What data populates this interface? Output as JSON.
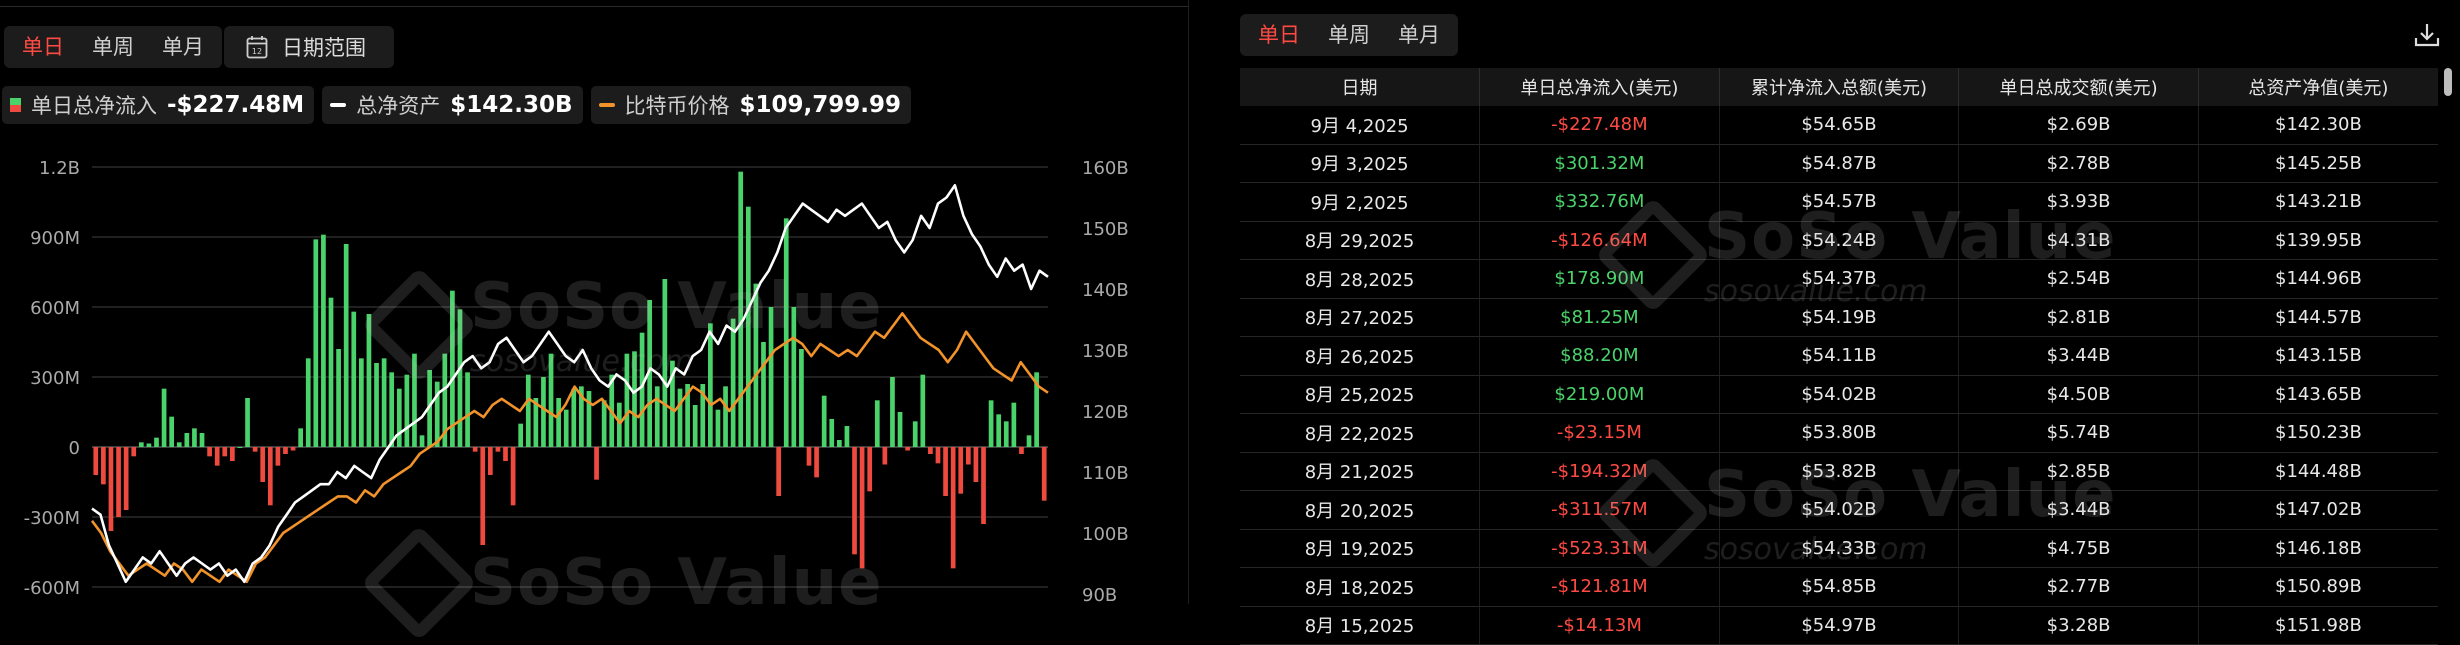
{
  "left_tabs": [
    "单日",
    "单周",
    "单月"
  ],
  "date_range_label": "日期范围",
  "date_icon_text": "12",
  "legend": {
    "flow": {
      "label": "单日总净流入",
      "value": "-$227.48M"
    },
    "assets": {
      "label": "总净资产",
      "value": "$142.30B"
    },
    "price": {
      "label": "比特币价格",
      "value": "$109,799.99"
    }
  },
  "watermark": {
    "text": "SoSo Value",
    "sub": "sosovalue.com"
  },
  "colors": {
    "accent": "#ff4a43",
    "inflow": "#4ad36a",
    "outflow": "#ef4a3f",
    "assets_line": "#ffffff",
    "price_line": "#f2922a"
  },
  "chart_data": {
    "type": "bar",
    "left_axis": {
      "ticks": [
        "1.2B",
        "900M",
        "600M",
        "300M",
        "0",
        "-300M",
        "-600M"
      ],
      "range": [
        -680,
        1200
      ]
    },
    "right_axis": {
      "ticks": [
        "160B",
        "150B",
        "140B",
        "130B",
        "120B",
        "110B",
        "100B",
        "90B"
      ],
      "range": [
        88,
        160
      ]
    },
    "series": [
      {
        "name": "单日总净流入",
        "type": "bar",
        "unit": "M",
        "values": [
          -120,
          -160,
          -360,
          -300,
          -270,
          -40,
          20,
          15,
          40,
          250,
          130,
          20,
          60,
          80,
          60,
          -40,
          -80,
          -40,
          -60,
          0,
          210,
          -20,
          -150,
          -250,
          -80,
          -30,
          -15,
          80,
          380,
          890,
          910,
          640,
          420,
          870,
          580,
          380,
          570,
          360,
          380,
          320,
          250,
          310,
          400,
          50,
          330,
          280,
          400,
          670,
          590,
          320,
          -20,
          -420,
          -120,
          -20,
          -60,
          -250,
          100,
          310,
          210,
          300,
          400,
          210,
          160,
          250,
          260,
          240,
          -140,
          200,
          310,
          190,
          400,
          410,
          490,
          630,
          260,
          720,
          370,
          250,
          270,
          180,
          270,
          530,
          160,
          260,
          550,
          1180,
          1030,
          700,
          450,
          600,
          -210,
          980,
          600,
          420,
          -80,
          -130,
          220,
          120,
          30,
          90,
          -460,
          -520,
          -190,
          200,
          -75,
          300,
          150,
          -15,
          110,
          310,
          -30,
          -70,
          -210,
          -520,
          -200,
          -75,
          -150,
          -330,
          200,
          140,
          110,
          190,
          -30,
          50,
          320,
          -230
        ]
      },
      {
        "name": "总净资产",
        "type": "line",
        "unit": "B",
        "values": [
          104,
          103,
          98,
          95,
          92,
          94,
          96,
          95,
          97,
          95,
          93,
          95,
          96,
          95,
          94,
          95,
          93,
          94,
          92,
          95,
          96,
          98,
          101,
          103,
          105,
          106,
          107,
          108,
          108,
          110,
          109,
          111,
          110,
          109,
          112,
          114,
          116,
          117,
          118,
          119,
          121,
          123,
          124,
          126,
          128,
          129,
          127,
          128,
          131,
          132,
          130,
          128,
          129,
          131,
          133,
          131,
          129,
          128,
          130,
          127,
          125,
          124,
          126,
          125,
          123,
          124,
          127,
          126,
          124,
          127,
          126,
          129,
          130,
          133,
          131,
          134,
          133,
          135,
          138,
          141,
          143,
          146,
          150,
          152,
          154,
          153,
          152,
          151,
          153,
          152,
          153,
          154,
          152,
          150,
          151,
          148,
          146,
          148,
          152,
          150,
          154,
          155,
          157,
          152,
          149,
          147,
          144,
          142,
          145,
          143,
          144,
          140,
          143,
          142
        ]
      },
      {
        "name": "比特币价格",
        "type": "line",
        "unit": "B",
        "values": [
          102,
          100,
          97,
          95,
          93,
          94,
          95,
          94,
          93,
          95,
          94,
          92,
          94,
          93,
          92,
          94,
          93,
          92,
          95,
          96,
          98,
          100,
          101,
          102,
          103,
          104,
          105,
          106,
          106,
          105,
          107,
          106,
          108,
          109,
          110,
          111,
          113,
          114,
          115,
          117,
          118,
          119,
          120,
          119,
          121,
          122,
          121,
          120,
          122,
          121,
          120,
          119,
          121,
          124,
          122,
          121,
          122,
          120,
          118,
          120,
          119,
          121,
          122,
          121,
          120,
          122,
          124,
          123,
          121,
          122,
          120,
          122,
          124,
          126,
          128,
          130,
          131,
          132,
          131,
          129,
          131,
          130,
          129,
          130,
          129,
          131,
          133,
          132,
          134,
          136,
          134,
          132,
          131,
          130,
          128,
          130,
          133,
          131,
          129,
          127,
          126,
          125,
          128,
          126,
          124,
          123
        ]
      }
    ]
  },
  "table": {
    "columns": [
      "日期",
      "单日总净流入(美元)",
      "累计净流入总额(美元)",
      "单日总成交额(美元)",
      "总资产净值(美元)"
    ],
    "rows": [
      [
        "9月 4,2025",
        "-$227.48M",
        "$54.65B",
        "$2.69B",
        "$142.30B"
      ],
      [
        "9月 3,2025",
        "$301.32M",
        "$54.87B",
        "$2.78B",
        "$145.25B"
      ],
      [
        "9月 2,2025",
        "$332.76M",
        "$54.57B",
        "$3.93B",
        "$143.21B"
      ],
      [
        "8月 29,2025",
        "-$126.64M",
        "$54.24B",
        "$4.31B",
        "$139.95B"
      ],
      [
        "8月 28,2025",
        "$178.90M",
        "$54.37B",
        "$2.54B",
        "$144.96B"
      ],
      [
        "8月 27,2025",
        "$81.25M",
        "$54.19B",
        "$2.81B",
        "$144.57B"
      ],
      [
        "8月 26,2025",
        "$88.20M",
        "$54.11B",
        "$3.44B",
        "$143.15B"
      ],
      [
        "8月 25,2025",
        "$219.00M",
        "$54.02B",
        "$4.50B",
        "$143.65B"
      ],
      [
        "8月 22,2025",
        "-$23.15M",
        "$53.80B",
        "$5.74B",
        "$150.23B"
      ],
      [
        "8月 21,2025",
        "-$194.32M",
        "$53.82B",
        "$2.85B",
        "$144.48B"
      ],
      [
        "8月 20,2025",
        "-$311.57M",
        "$54.02B",
        "$3.44B",
        "$147.02B"
      ],
      [
        "8月 19,2025",
        "-$523.31M",
        "$54.33B",
        "$4.75B",
        "$146.18B"
      ],
      [
        "8月 18,2025",
        "-$121.81M",
        "$54.85B",
        "$2.77B",
        "$150.89B"
      ],
      [
        "8月 15,2025",
        "-$14.13M",
        "$54.97B",
        "$3.28B",
        "$151.98B"
      ]
    ]
  }
}
